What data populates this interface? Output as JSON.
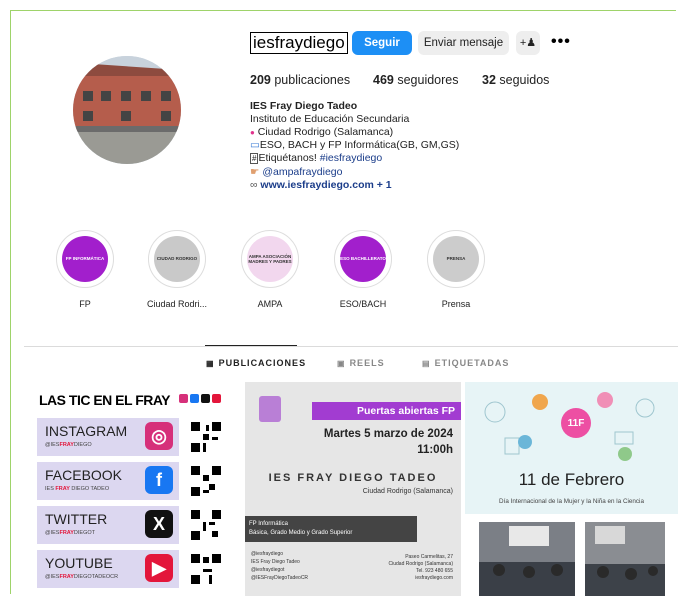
{
  "profile": {
    "username": "iesfraydiego",
    "follow_label": "Seguir",
    "message_label": "Enviar mensaje",
    "add_icon": "+♟",
    "more_icon": "•••",
    "stats": {
      "posts_count": "209",
      "posts_label": "publicaciones",
      "followers_count": "469",
      "followers_label": "seguidores",
      "following_count": "32",
      "following_label": "seguidos"
    },
    "bio": {
      "name": "IES Fray Diego Tadeo",
      "category": "Instituto de Educación Secundaria",
      "line1_icon": "●",
      "line1": "Ciudad Rodrigo (Salamanca)",
      "line2_icon": "▭",
      "line2": "ESO, BACH y FP Informática(GB, GM,GS)",
      "line3_icon": "#",
      "line3_text": "Etiquétanos! ",
      "line3_tag": "#iesfraydiego",
      "line4_icon": "☛",
      "line4": "@ampafraydiego",
      "link_icon": "∞",
      "link": "www.iesfraydiego.com + 1"
    }
  },
  "highlights": [
    {
      "label": "FP",
      "inner_text": "FP INFORMÁTICA",
      "bg": "#a21fcc",
      "fg": "#ffffff"
    },
    {
      "label": "Ciudad Rodri...",
      "inner_text": "CIUDAD RODRIGO",
      "bg": "#c9c9c9",
      "fg": "#333333"
    },
    {
      "label": "AMPA",
      "inner_text": "AMPA ASOCIACIÓN MADRES Y PADRES",
      "bg": "#f2d7ee",
      "fg": "#333333"
    },
    {
      "label": "ESO/BACH",
      "inner_text": "ESO BACHILLERATO",
      "bg": "#a21fcc",
      "fg": "#ffffff"
    },
    {
      "label": "Prensa",
      "inner_text": "PRENSA",
      "bg": "#cccccc",
      "fg": "#333333"
    }
  ],
  "tabs": [
    {
      "label": "PUBLICACIONES",
      "icon": "▦",
      "active": true
    },
    {
      "label": "REELS",
      "icon": "▣",
      "active": false
    },
    {
      "label": "ETIQUETADAS",
      "icon": "▤",
      "active": false
    }
  ],
  "posts": {
    "p1": {
      "title": "LAS TIC EN EL FRAY",
      "rows": [
        {
          "network": "INSTAGRAM",
          "handle_pre": "@IES",
          "handle_hi": "FRAY",
          "handle_post": "DIEGO",
          "icon": "◎",
          "icon_bg": "#d6307a"
        },
        {
          "network": "FACEBOOK",
          "handle_pre": "IES ",
          "handle_hi": "FRAY",
          "handle_post": " DIEGO TADEO",
          "icon": "f",
          "icon_bg": "#1877f2"
        },
        {
          "network": "TWITTER",
          "handle_pre": "@IES",
          "handle_hi": "FRAY",
          "handle_post": "DIEGOT",
          "icon": "X",
          "icon_bg": "#111111"
        },
        {
          "network": "YOUTUBE",
          "handle_pre": "@IES",
          "handle_hi": "FRAY",
          "handle_post": "DIEGOTADEOCR",
          "icon": "▶",
          "icon_bg": "#e3163b"
        }
      ]
    },
    "p2": {
      "band": "Puertas abiertas FP",
      "date_line1": "Martes 5 marzo de 2024",
      "date_line2": "11:00h",
      "school": "IES FRAY DIEGO TADEO",
      "city": "Ciudad Rodrigo (Salamanca)",
      "fp_line1": "FP Informática",
      "fp_line2": "Básica, Grado Medio y Grado Superior",
      "contacts": [
        "@iesfraydiego",
        "IES Fray Diego Tadeo",
        "@iesfraydiegot",
        "@IESFrayDiegoTadeoCR"
      ],
      "addr_line1": "Paseo Carmelitas, 27",
      "addr_line2": "Ciudad Rodrigo (Salamanca)",
      "addr_line3": "Tel. 923 480 655",
      "addr_line4": "iesfraydiego.com"
    },
    "p3": {
      "badge": "11F",
      "title": "11 de Febrero",
      "subtitle": "Día Internacional de la Mujer y la Niña en la Ciencia"
    }
  }
}
